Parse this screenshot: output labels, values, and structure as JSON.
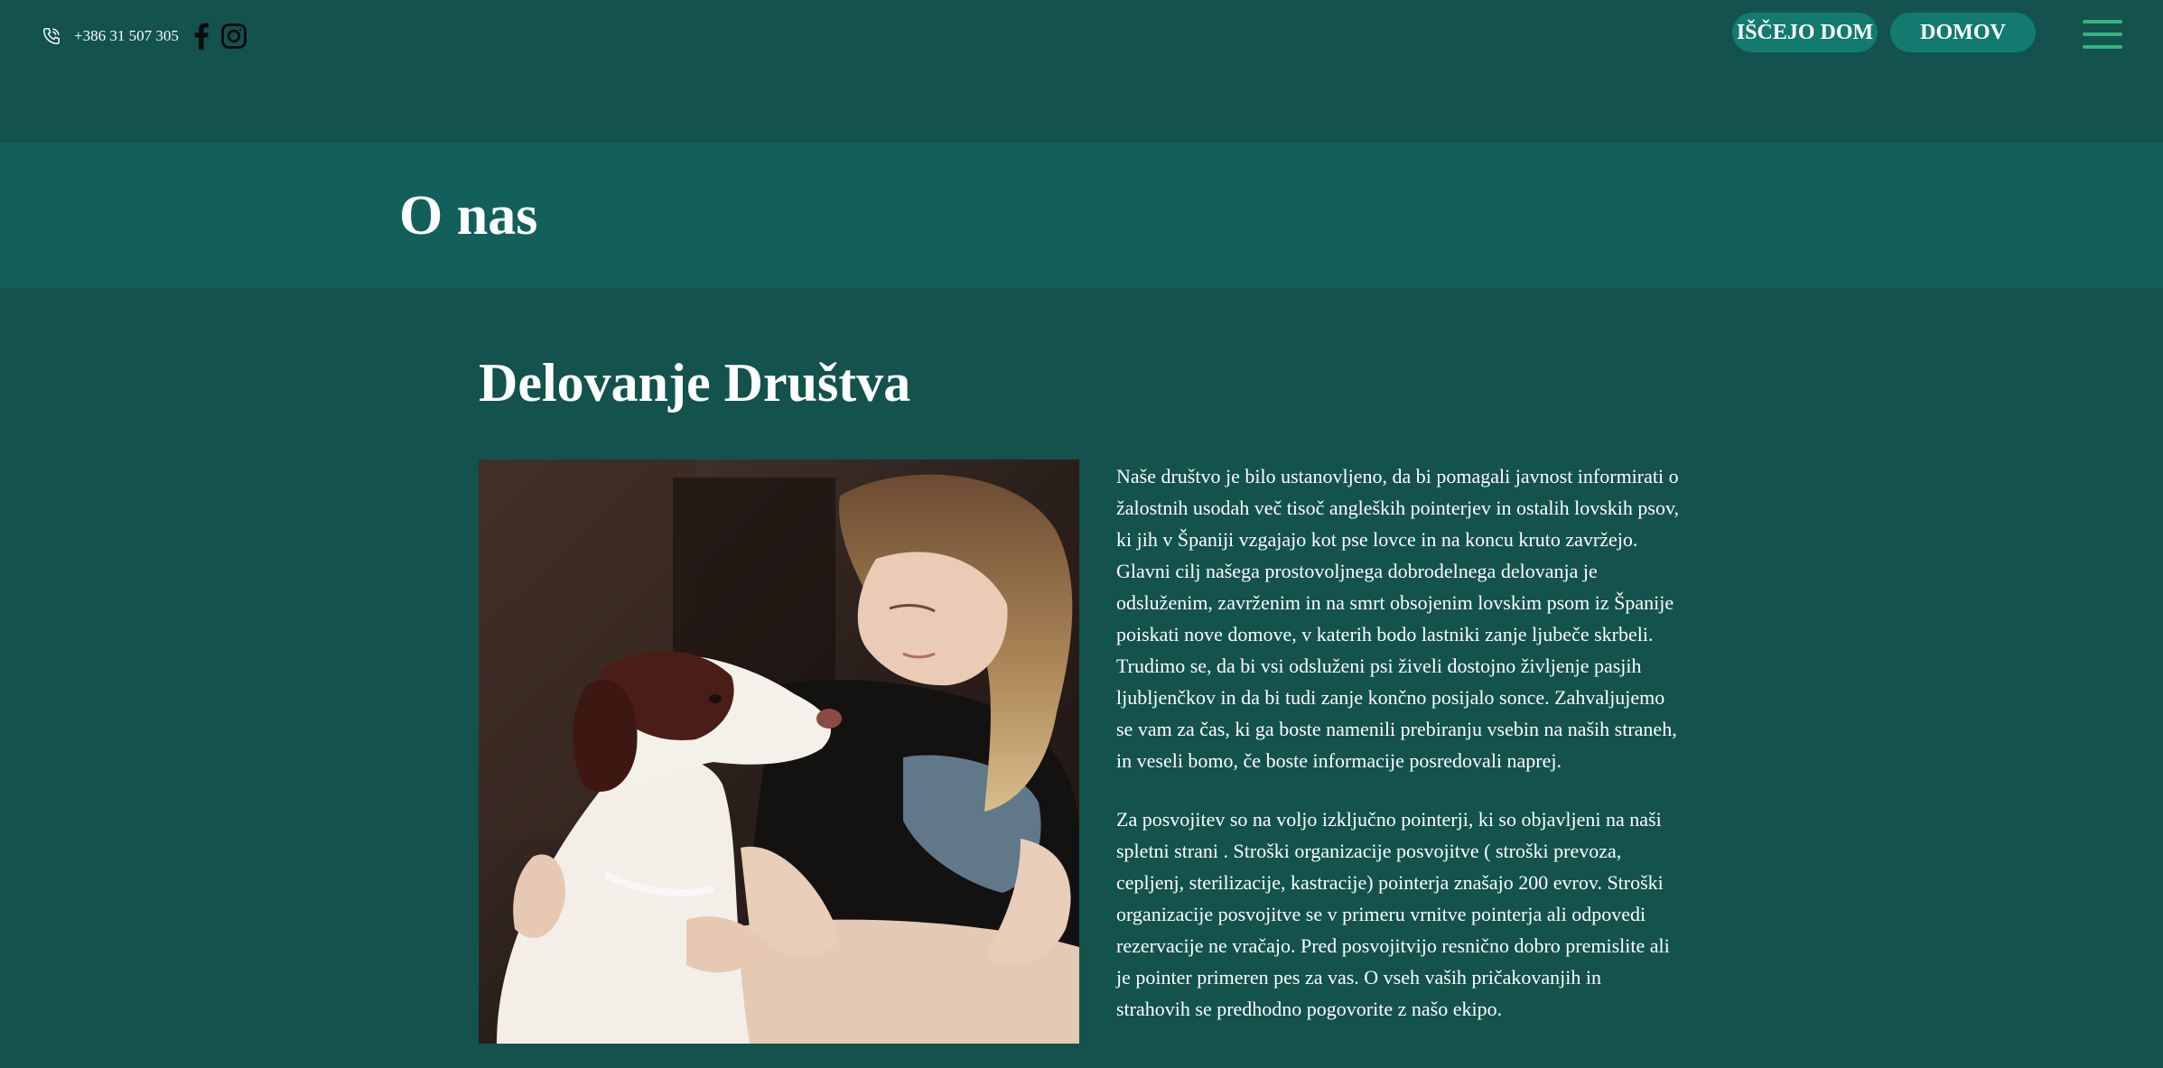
{
  "header": {
    "phone": "+386 31 507 305",
    "social_icons": [
      "facebook-icon",
      "instagram-icon"
    ],
    "buttons": {
      "lost_home": "IŠČEJO DOM",
      "home": "DOMOV"
    },
    "menu_icon": "hamburger-menu-icon"
  },
  "banner": {
    "title": "O nas"
  },
  "main": {
    "heading": "Delovanje Društva",
    "paragraphs": [
      "Naše društvo je bilo ustanovljeno, da bi pomagali javnost informirati o žalostnih usodah več tisoč angleških pointerjev in ostalih lovskih psov, ki jih v Španiji vzgajajo kot pse lovce in na koncu kruto zavržejo. Glavni cilj našega prostovoljnega dobrodelnega delovanja je odsluženim, zavrženim in na smrt obsojenim lovskim psom iz Španije poiskati nove domove, v katerih bodo lastniki zanje ljubeče skrbeli. Trudimo se, da bi vsi odsluženi psi živeli dostojno življenje pasjih ljubljenčkov in da bi tudi zanje končno posijalo sonce. Zahvaljujemo se vam za čas, ki ga boste namenili prebiranju vsebin na naših straneh, in veseli bomo, če boste informacije posredovali naprej.",
      "Za posvojitev so na voljo izključno pointerji, ki so objavljeni na naši spletni strani . Stroški organizacije posvojitve ( stroški prevoza, cepljenj, sterilizacije, kastracije) pointerja znašajo 200 evrov. Stroški organizacije posvojitve se v primeru vrnitve pointerja ali odpovedi rezervacije ne vračajo. Pred posvojitvijo resnično dobro premislite ali je pointer primeren pes za vas. O vseh vaših pričakovanjih in strahovih se predhodno pogovorite z našo ekipo."
    ]
  },
  "colors": {
    "page_bg": "#13524d",
    "banner_bg": "#135f5a",
    "button_bg": "#137a70",
    "menu_icon": "#36b37e",
    "text": "#ffffff"
  }
}
